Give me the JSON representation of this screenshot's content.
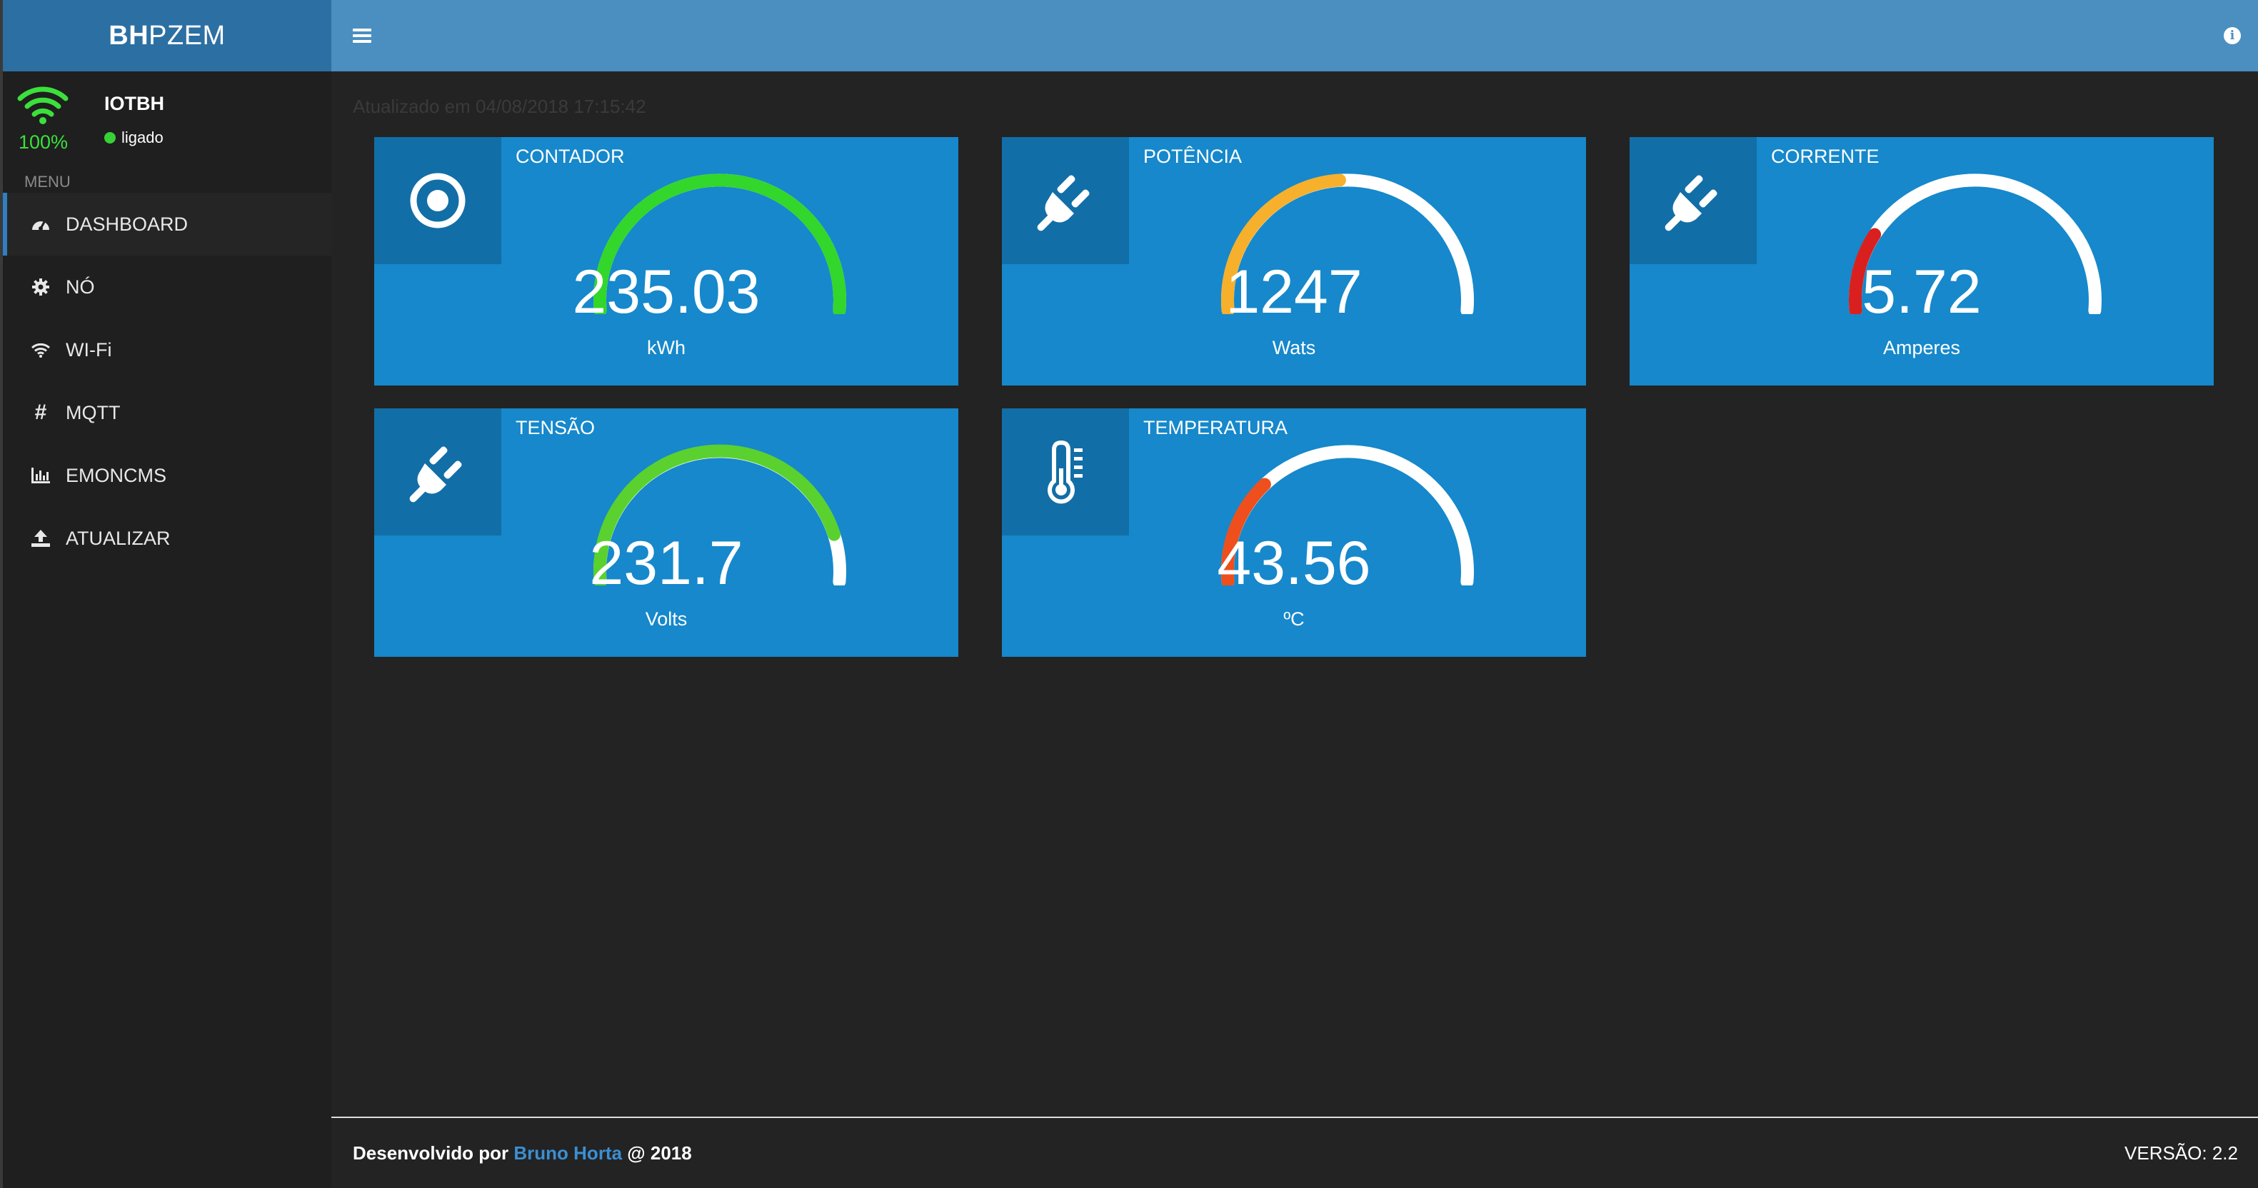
{
  "brand": {
    "bold": "BH",
    "light": "PZEM"
  },
  "wifi": {
    "ssid": "IOTBH",
    "signal": "100%",
    "status": "ligado",
    "icon": "wifi-icon"
  },
  "sidebar": {
    "header": "MENU",
    "items": [
      {
        "label": "DASHBOARD",
        "icon": "dashboard-icon"
      },
      {
        "label": "NÓ",
        "icon": "gear-icon"
      },
      {
        "label": "WI-Fi",
        "icon": "wifi-icon"
      },
      {
        "label": "MQTT",
        "icon": "hash-icon"
      },
      {
        "label": "EMONCMS",
        "icon": "bar-chart-icon"
      },
      {
        "label": "ATUALIZAR",
        "icon": "upload-icon"
      }
    ]
  },
  "topbar": {
    "menu_icon": "hamburger-icon",
    "info_icon": "info-icon"
  },
  "updated": "Atualizado em 04/08/2018 17:15:42",
  "cards": [
    {
      "title": "CONTADOR",
      "value": "235.03",
      "unit": "kWh",
      "icon": "target-icon",
      "fill": 1.0,
      "color": "#33d62b"
    },
    {
      "title": "POTÊNCIA",
      "value": "1247",
      "unit": "Wats",
      "icon": "plug-icon",
      "fill": 0.48,
      "color": "#f6b02c"
    },
    {
      "title": "CORRENTE",
      "value": "5.72",
      "unit": "Amperes",
      "icon": "plug-icon",
      "fill": 0.2,
      "color": "#d9201f"
    },
    {
      "title": "TENSÃO",
      "value": "231.7",
      "unit": "Volts",
      "icon": "plug-icon",
      "fill": 0.88,
      "color": "#5ad12e"
    },
    {
      "title": "TEMPERATURA",
      "value": "43.56",
      "unit": "ºC",
      "icon": "thermometer-icon",
      "fill": 0.27,
      "color": "#ee4f1c"
    }
  ],
  "footer": {
    "prefix": "Desenvolvido por",
    "author": "Bruno Horta",
    "suffix": "@ 2018",
    "version": "VERSÃO: 2.2"
  }
}
